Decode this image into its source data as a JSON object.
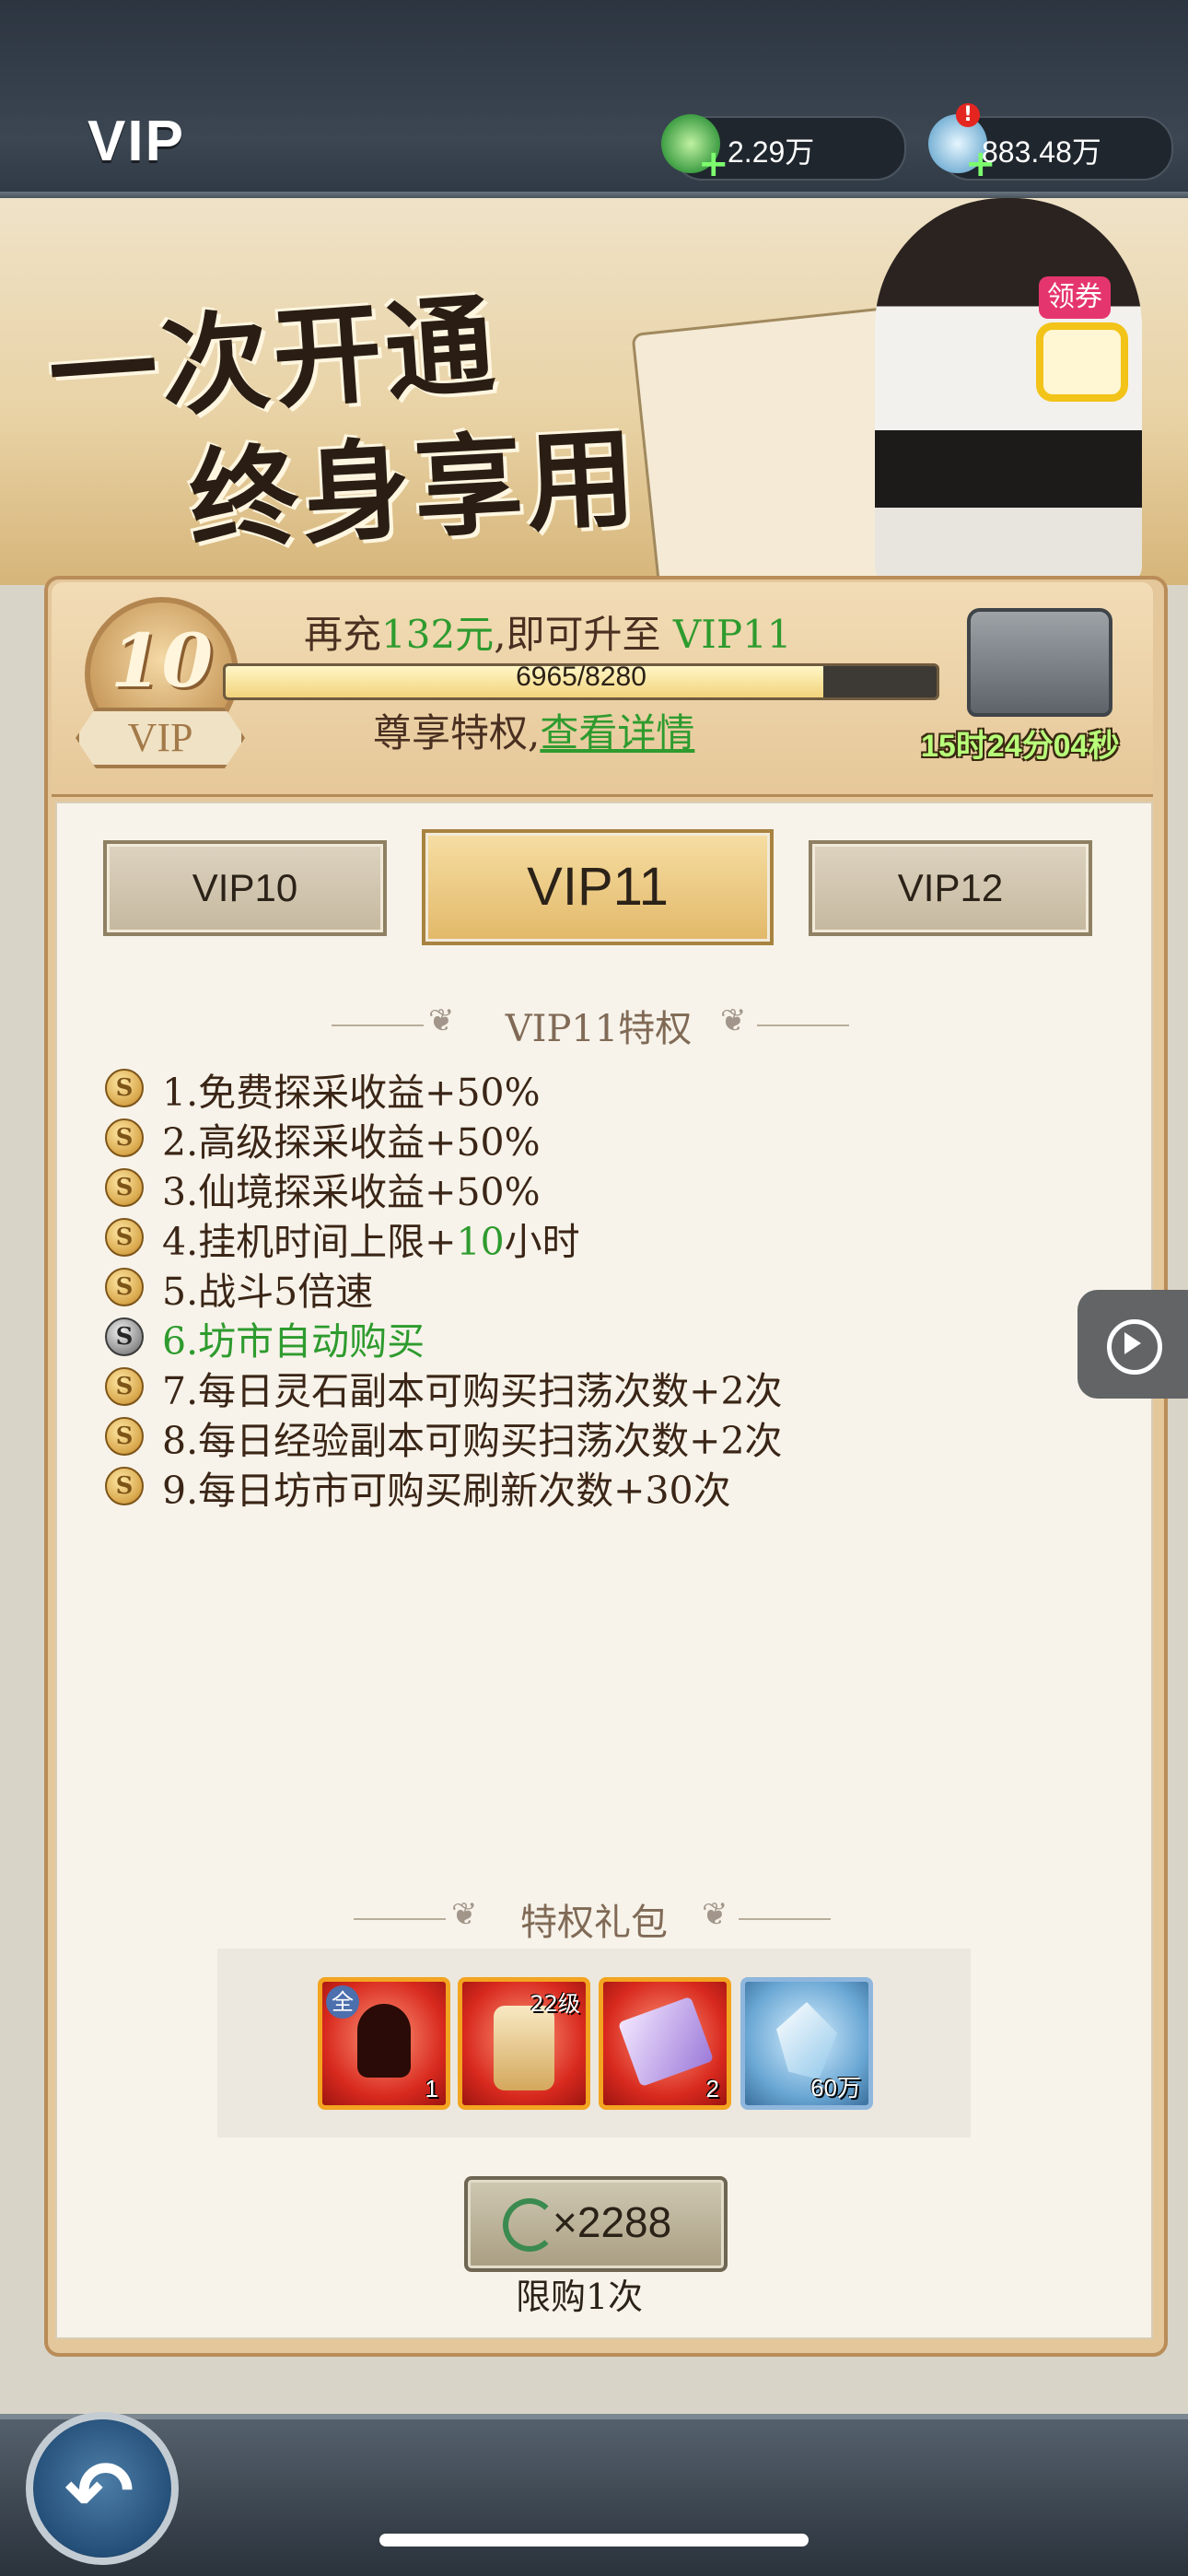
{
  "header": {
    "title": "VIP",
    "resources": [
      {
        "name": "jade-coin",
        "value": "2.29万"
      },
      {
        "name": "spirit-stone",
        "value": "883.48万"
      }
    ]
  },
  "banner": {
    "slogan_line1": "一次开通",
    "slogan_line2": "终身享用",
    "coupon_label": "领券"
  },
  "vip_status": {
    "level": "10",
    "badge_label": "VIP",
    "recharge_prefix": "再充",
    "recharge_amount": "132元",
    "recharge_mid": ",即可升至 ",
    "next_level": "VIP11",
    "progress_text": "6965/8280",
    "progress_fraction": 0.841,
    "privilege_prefix": "尊享特权,",
    "privilege_link": "查看详情",
    "countdown": "15时24分04秒"
  },
  "tabs": [
    {
      "label": "VIP10",
      "active": false
    },
    {
      "label": "VIP11",
      "active": true
    },
    {
      "label": "VIP12",
      "active": false
    }
  ],
  "perks_title": "VIP11特权",
  "perks": [
    {
      "text": "1.免费探采收益+50%",
      "highlight": false
    },
    {
      "text": "2.高级探采收益+50%",
      "highlight": false
    },
    {
      "text": "3.仙境探采收益+50%",
      "highlight": false
    },
    {
      "text_pre": "4.挂机时间上限+",
      "text_green": "10",
      "text_post": "小时",
      "highlight": false
    },
    {
      "text": "5.战斗5倍速",
      "highlight": false
    },
    {
      "text": "6.坊市自动购买",
      "highlight": true
    },
    {
      "text": "7.每日灵石副本可购买扫荡次数+2次",
      "highlight": false
    },
    {
      "text": "8.每日经验副本可购买扫荡次数+2次",
      "highlight": false
    },
    {
      "text": "9.每日坊市可购买刷新次数+30次",
      "highlight": false
    }
  ],
  "gift_section": {
    "title": "特权礼包",
    "items": [
      {
        "icon": "shadow-figure-icon",
        "count": "1",
        "tag": "全"
      },
      {
        "icon": "robe-icon",
        "level": "22级"
      },
      {
        "icon": "scroll-icon",
        "count": "2"
      },
      {
        "icon": "crystal-icon",
        "count": "60万"
      }
    ],
    "price": "×2288",
    "limit": "限购1次"
  },
  "colors": {
    "accent_green": "#2e9b2e",
    "gold": "#e2b869",
    "top_bar": "#3b4652"
  }
}
